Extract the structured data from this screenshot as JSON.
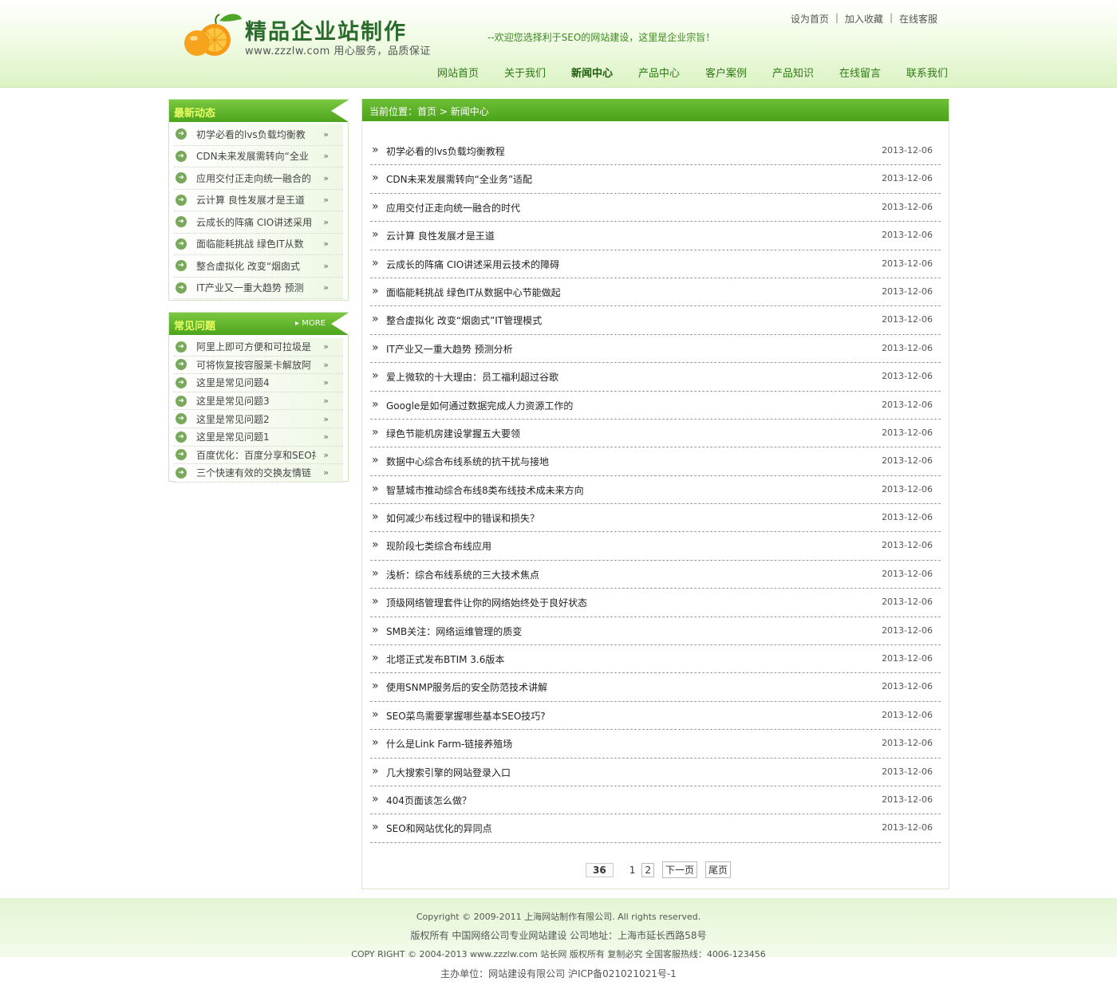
{
  "header": {
    "logo_title": "精品企业站制作",
    "logo_sub": "www.zzzlw.com 用心服务，品质保证",
    "slogan": "--欢迎您选择利于SEO的网站建设，这里是企业宗旨！",
    "top_links": [
      "设为首页",
      "加入收藏",
      "在线客服"
    ],
    "nav": [
      "网站首页",
      "关于我们",
      "新闻中心",
      "产品中心",
      "客户案例",
      "产品知识",
      "在线留言",
      "联系我们"
    ],
    "nav_active": "新闻中心"
  },
  "sidebar": {
    "latest": {
      "title": "最新动态",
      "items": [
        "初学必看的lvs负载均衡教",
        "CDN未来发展需转向“全业",
        "应用交付正走向统一融合的",
        "云计算 良性发展才是王道",
        "云成长的阵痛 CIO讲述采用",
        "面临能耗挑战 绿色IT从数",
        "整合虚拟化 改变“烟囱式",
        "IT产业又一重大趋势 预测"
      ]
    },
    "faq": {
      "title": "常见问题",
      "more": "MORE",
      "items": [
        "阿里上即可方便和可拉圾是",
        "可将恢复按容服莱卡解放阿",
        "这里是常见问题4",
        "这里是常见问题3",
        "这里是常见问题2",
        "这里是常见问题1",
        "百度优化：百度分享和SEO排",
        "三个快速有效的交换友情链"
      ]
    }
  },
  "main": {
    "breadcrumb_prefix": "当前位置：",
    "breadcrumb_home": "首页",
    "breadcrumb_sep": ">",
    "breadcrumb_current": "新闻中心",
    "news": [
      {
        "title": "初学必看的lvs负载均衡教程",
        "date": "2013-12-06"
      },
      {
        "title": "CDN未来发展需转向“全业务”适配",
        "date": "2013-12-06"
      },
      {
        "title": "应用交付正走向统一融合的时代",
        "date": "2013-12-06"
      },
      {
        "title": "云计算 良性发展才是王道",
        "date": "2013-12-06"
      },
      {
        "title": "云成长的阵痛 CIO讲述采用云技术的障碍",
        "date": "2013-12-06"
      },
      {
        "title": "面临能耗挑战 绿色IT从数据中心节能做起",
        "date": "2013-12-06"
      },
      {
        "title": "整合虚拟化 改变“烟囱式”IT管理模式",
        "date": "2013-12-06"
      },
      {
        "title": "IT产业又一重大趋势 预测分析",
        "date": "2013-12-06"
      },
      {
        "title": "爱上微软的十大理由：员工福利超过谷歌",
        "date": "2013-12-06"
      },
      {
        "title": "Google是如何通过数据完成人力资源工作的",
        "date": "2013-12-06"
      },
      {
        "title": "绿色节能机房建设掌握五大要领",
        "date": "2013-12-06"
      },
      {
        "title": "数据中心综合布线系统的抗干扰与接地",
        "date": "2013-12-06"
      },
      {
        "title": "智慧城市推动综合布线8类布线技术成未来方向",
        "date": "2013-12-06"
      },
      {
        "title": "如何减少布线过程中的错误和损失？",
        "date": "2013-12-06"
      },
      {
        "title": "现阶段七类综合布线应用",
        "date": "2013-12-06"
      },
      {
        "title": "浅析：综合布线系统的三大技术焦点",
        "date": "2013-12-06"
      },
      {
        "title": "顶级网络管理套件让你的网络始终处于良好状态",
        "date": "2013-12-06"
      },
      {
        "title": "SMB关注：网络运维管理的质变",
        "date": "2013-12-06"
      },
      {
        "title": "北塔正式发布BTIM 3.6版本",
        "date": "2013-12-06"
      },
      {
        "title": "使用SNMP服务后的安全防范技术讲解",
        "date": "2013-12-06"
      },
      {
        "title": "SEO菜鸟需要掌握哪些基本SEO技巧?",
        "date": "2013-12-06"
      },
      {
        "title": "什么是Link Farm-链接养殖场",
        "date": "2013-12-06"
      },
      {
        "title": "几大搜索引擎的网站登录入口",
        "date": "2013-12-06"
      },
      {
        "title": "404页面该怎么做？",
        "date": "2013-12-06"
      },
      {
        "title": "SEO和网站优化的异同点",
        "date": "2013-12-06"
      }
    ],
    "pager": {
      "total": "36",
      "current": "1",
      "page2": "2",
      "next": "下一页",
      "last": "尾页"
    }
  },
  "footer": {
    "line1": "Copyright © 2009-2011 上海网站制作有限公司. All rights reserved.",
    "line2": "版权所有 中国网络公司专业网站建设 公司地址：上海市延长西路58号",
    "line3": "COPY RIGHT © 2004-2013 www.zzzlw.com 站长网 版权所有 复制必究 全国客服热线：4006-123456",
    "line4": "主办单位：网站建设有限公司 沪ICP备021021021号-1"
  },
  "colors": {
    "accent_green": "#4ca51c",
    "title_yellow": "#e8ff64",
    "nav_green": "#2d7a14"
  }
}
